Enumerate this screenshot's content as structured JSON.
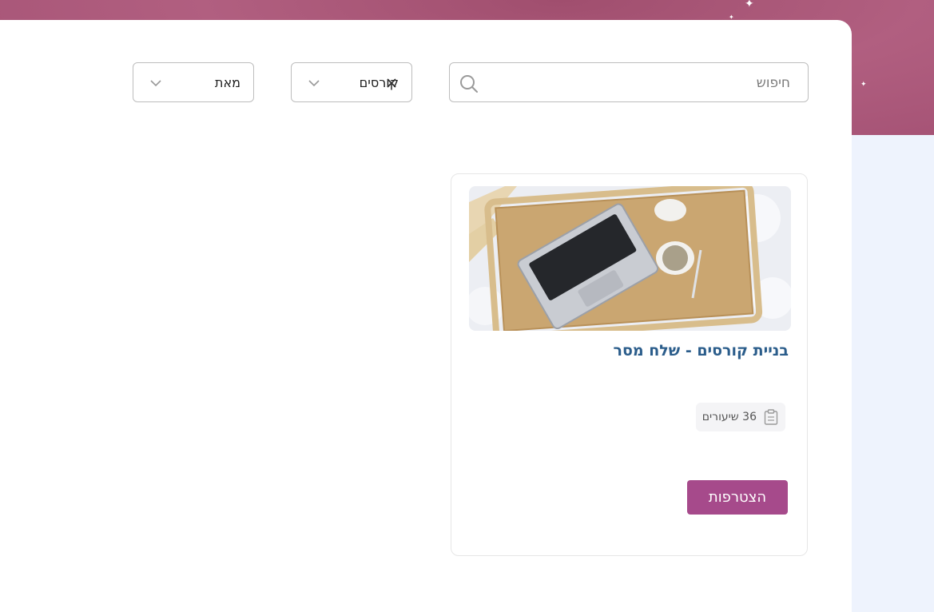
{
  "search": {
    "placeholder": "חיפוש"
  },
  "filters": {
    "type_value": "קורסים",
    "sort_value": "מאת"
  },
  "course_card": {
    "title": "בניית קורסים - שלח מסר",
    "lessons_label": "36 שיעורים",
    "join_label": "הצטרפות"
  },
  "colors": {
    "hero": "#b15f80",
    "title": "#2b5d8b",
    "button": "#a64a8b",
    "side_bg": "#eef3fd"
  }
}
